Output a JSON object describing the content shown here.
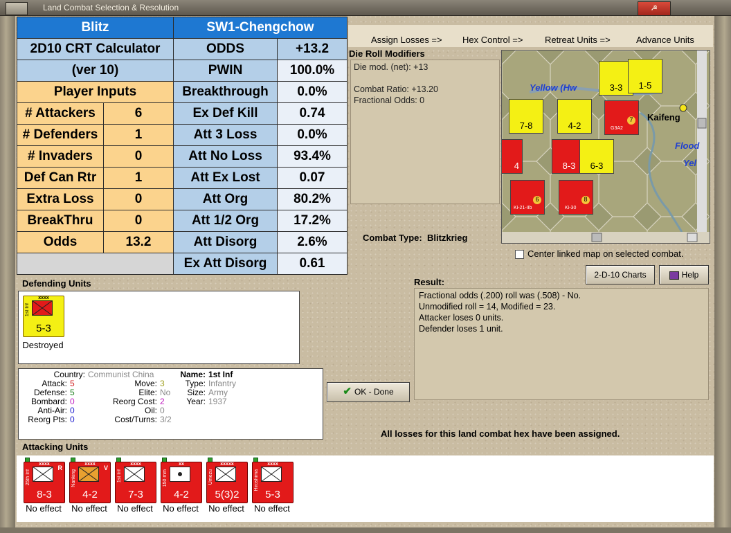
{
  "window": {
    "title": "Land Combat Selection & Resolution",
    "close_label": "☭"
  },
  "crt": {
    "rows": [
      {
        "a": "Blitz",
        "b": "",
        "c": "SW1-Chengchow",
        "d": ""
      },
      {
        "a": "2D10 CRT Calculator",
        "c": "ODDS",
        "d": "+13.2"
      },
      {
        "a": "(ver 10)",
        "c": "PWIN",
        "d": "100.0%"
      },
      {
        "a": "Player Inputs",
        "c": "Breakthrough",
        "d": "0.0%"
      },
      {
        "a": "# Attackers",
        "b": "6",
        "c": "Ex Def Kill",
        "d": "0.74"
      },
      {
        "a": "# Defenders",
        "b": "1",
        "c": "Att 3 Loss",
        "d": "0.0%"
      },
      {
        "a": "# Invaders",
        "b": "0",
        "c": "Att No Loss",
        "d": "93.4%"
      },
      {
        "a": "Def Can Rtr",
        "b": "1",
        "c": "Att Ex Lost",
        "d": "0.07"
      },
      {
        "a": "Extra Loss",
        "b": "0",
        "c": "Att Org",
        "d": "80.2%"
      },
      {
        "a": "BreakThru",
        "b": "0",
        "c": "Att 1/2 Org",
        "d": "17.2%"
      },
      {
        "a": "Odds",
        "b": "13.2",
        "c": "Att Disorg",
        "d": "2.6%"
      },
      {
        "a": "",
        "b": "",
        "c": "Ex Att Disorg",
        "d": "0.61"
      }
    ]
  },
  "nav": {
    "assign": "Assign Losses =>",
    "hex": "Hex Control =>",
    "retreat": "Retreat Units =>",
    "advance": "Advance Units"
  },
  "die": {
    "title": "Die Roll Modifiers",
    "lines": [
      "Die mod. (net): +13",
      "",
      "Combat Ratio: +13.20",
      "Fractional Odds: 0"
    ]
  },
  "map": {
    "labels": {
      "yellow": "Yellow (Hw",
      "kaifeng": "Kaifeng",
      "flood": "Flood",
      "yel": "Yel"
    },
    "units": [
      {
        "val": "3-3",
        "color": "yellow"
      },
      {
        "val": "1-5",
        "color": "yellow"
      },
      {
        "val": "7-8",
        "color": "yellow"
      },
      {
        "val": "4-2",
        "color": "yellow"
      },
      {
        "val": "8-3",
        "color": "red"
      },
      {
        "val": "6-3",
        "color": "yellow"
      },
      {
        "val": "4",
        "color": "red"
      }
    ],
    "aircraft": [
      {
        "num": "7",
        "lbl": "G3A2"
      },
      {
        "num": "6",
        "lbl": "Ki-21-IIb"
      },
      {
        "num": "8",
        "lbl": "Ki-30"
      }
    ]
  },
  "combat": {
    "label": "Combat Type:",
    "value": "Blitzkrieg"
  },
  "center_map_label": "Center linked map on selected combat.",
  "buttons": {
    "charts": "2-D-10 Charts",
    "help": "Help",
    "ok": "OK - Done"
  },
  "result": {
    "title": "Result:",
    "lines": [
      "Fractional odds (.200) roll was (.508)  - No.",
      "Unmodified roll = 14, Modified = 23.",
      "Attacker loses 0 units.",
      "Defender loses 1 unit."
    ]
  },
  "defending": {
    "title": "Defending Units",
    "units": [
      {
        "side": "1st Inf",
        "size": "xxxx",
        "val": "5-3",
        "effect": "Destroyed"
      }
    ]
  },
  "info": {
    "country_lbl": "Country:",
    "country": "Communist China",
    "attack_lbl": "Attack:",
    "attack": "5",
    "defense_lbl": "Defense:",
    "defense": "5",
    "bombard_lbl": "Bombard:",
    "bombard": "0",
    "antiair_lbl": "Anti-Air:",
    "antiair": "0",
    "reorgpts_lbl": "Reorg Pts:",
    "reorgpts": "0",
    "move_lbl": "Move:",
    "move": "3",
    "elite_lbl": "Elite:",
    "elite": "No",
    "reorgcost_lbl": "Reorg Cost:",
    "reorgcost": "2",
    "oil_lbl": "Oil:",
    "oil": "0",
    "costturns_lbl": "Cost/Turns:",
    "costturns": "3/2",
    "name_lbl": "Name:",
    "name": "1st Inf",
    "type_lbl": "Type:",
    "type": "Infantry",
    "size_lbl": "Size:",
    "size": "Army",
    "year_lbl": "Year:",
    "year": "1937"
  },
  "losses_msg": "All losses for this land combat hex have been assigned.",
  "attacking": {
    "title": "Attacking Units",
    "units": [
      {
        "side": "25th Inf",
        "size": "xxxx",
        "val": "8-3",
        "effect": "No effect",
        "badge": "R"
      },
      {
        "side": "Nanking",
        "size": "xxxx",
        "val": "4-2",
        "effect": "No effect",
        "badge": "V"
      },
      {
        "side": "1st Inf",
        "size": "xxxx",
        "val": "7-3",
        "effect": "No effect",
        "badge": ""
      },
      {
        "side": "150 mm",
        "size": "xx",
        "val": "4-2",
        "effect": "No effect",
        "badge": ""
      },
      {
        "side": "Umezu",
        "size": "xxxxx",
        "val": "5(3)2",
        "effect": "No effect",
        "badge": ""
      },
      {
        "side": "Hiroshima",
        "size": "xxxx",
        "val": "5-3",
        "effect": "No effect",
        "badge": ""
      }
    ]
  }
}
